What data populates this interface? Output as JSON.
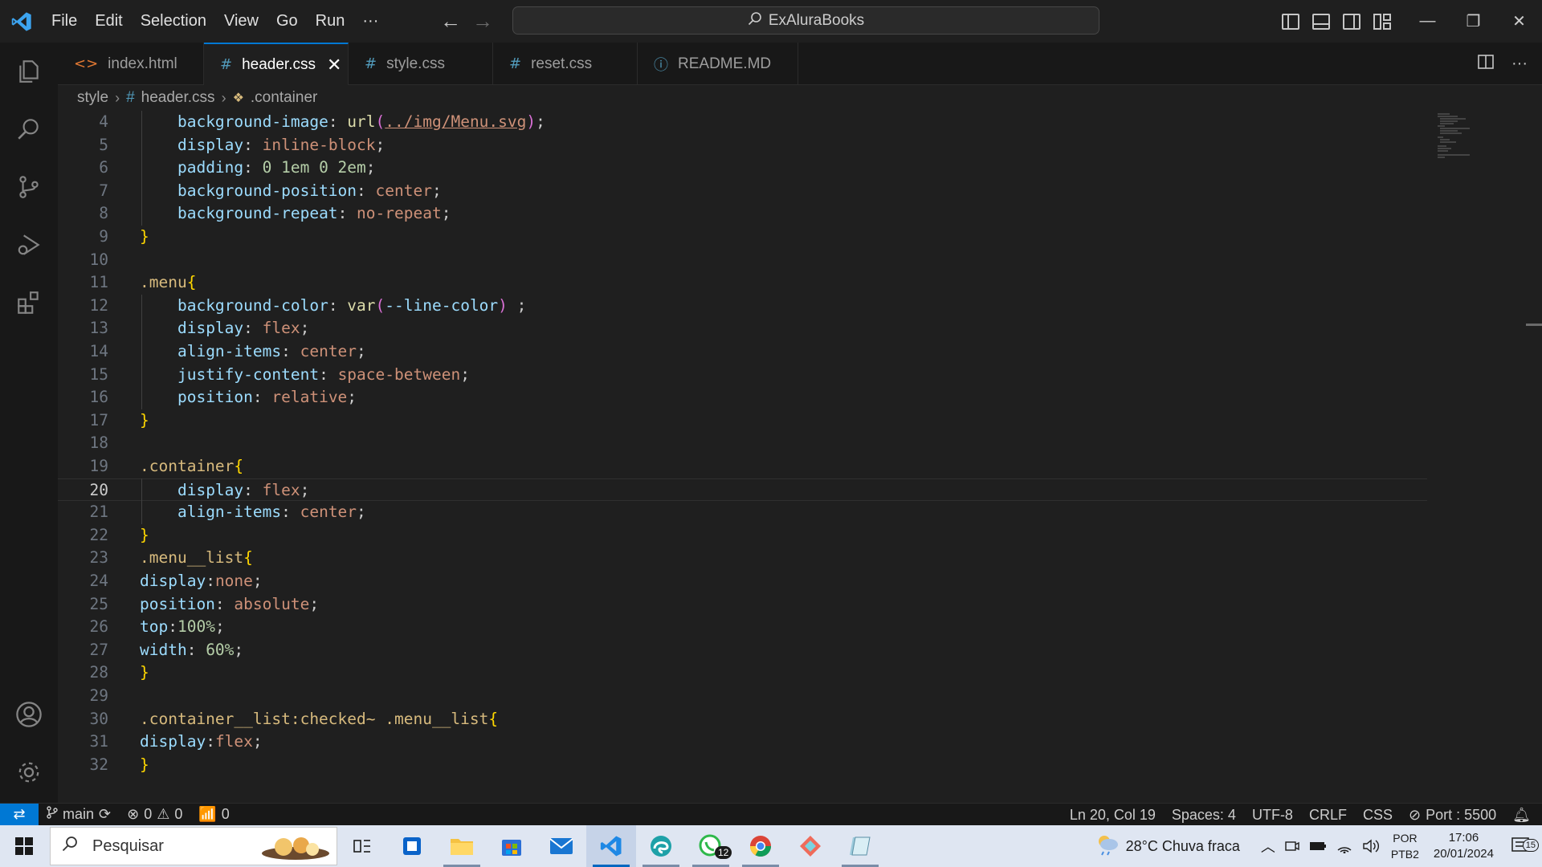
{
  "window": {
    "menu": [
      "File",
      "Edit",
      "Selection",
      "View",
      "Go",
      "Run",
      "···"
    ],
    "search_title": "ExAluraBooks",
    "nav_back_icon": "arrow-left-icon",
    "nav_forward_icon": "arrow-right-icon"
  },
  "tabs": [
    {
      "icon": "<>",
      "label": "index.html",
      "active": false,
      "icon_color": "#e37933"
    },
    {
      "icon": "#",
      "label": "header.css",
      "active": true,
      "icon_color": "#519aba"
    },
    {
      "icon": "#",
      "label": "style.css",
      "active": false,
      "icon_color": "#519aba"
    },
    {
      "icon": "#",
      "label": "reset.css",
      "active": false,
      "icon_color": "#519aba"
    },
    {
      "icon": "ⓘ",
      "label": "README.MD",
      "active": false,
      "icon_color": "#519aba"
    }
  ],
  "breadcrumb": {
    "folder": "style",
    "file": "header.css",
    "symbol": ".container"
  },
  "editor": {
    "current_line": 20,
    "lines": [
      {
        "n": "4",
        "tokens": [
          [
            "    ",
            ""
          ],
          [
            "background-image",
            "prop"
          ],
          [
            ": ",
            "punc"
          ],
          [
            "url",
            "fn"
          ],
          [
            "(",
            "brace2"
          ],
          [
            "../img/Menu.svg",
            "url"
          ],
          [
            ")",
            "brace2"
          ],
          [
            ";",
            "punc"
          ]
        ]
      },
      {
        "n": "5",
        "tokens": [
          [
            "    ",
            ""
          ],
          [
            "display",
            "prop"
          ],
          [
            ": ",
            "punc"
          ],
          [
            "inline-block",
            "val"
          ],
          [
            ";",
            "punc"
          ]
        ]
      },
      {
        "n": "6",
        "tokens": [
          [
            "    ",
            ""
          ],
          [
            "padding",
            "prop"
          ],
          [
            ": ",
            "punc"
          ],
          [
            "0 1em 0 2em",
            "num"
          ],
          [
            ";",
            "punc"
          ]
        ]
      },
      {
        "n": "7",
        "tokens": [
          [
            "    ",
            ""
          ],
          [
            "background-position",
            "prop"
          ],
          [
            ": ",
            "punc"
          ],
          [
            "center",
            "val"
          ],
          [
            ";",
            "punc"
          ]
        ]
      },
      {
        "n": "8",
        "tokens": [
          [
            "    ",
            ""
          ],
          [
            "background-repeat",
            "prop"
          ],
          [
            ": ",
            "punc"
          ],
          [
            "no-repeat",
            "val"
          ],
          [
            ";",
            "punc"
          ]
        ]
      },
      {
        "n": "9",
        "tokens": [
          [
            "}",
            "brace"
          ]
        ]
      },
      {
        "n": "10",
        "tokens": []
      },
      {
        "n": "11",
        "tokens": [
          [
            ".menu",
            "sel"
          ],
          [
            "{",
            "brace"
          ]
        ]
      },
      {
        "n": "12",
        "tokens": [
          [
            "    ",
            ""
          ],
          [
            "background-color",
            "prop"
          ],
          [
            ": ",
            "punc"
          ],
          [
            "var",
            "fn"
          ],
          [
            "(",
            "brace2"
          ],
          [
            "--line-color",
            "prop"
          ],
          [
            ")",
            "brace2"
          ],
          [
            " ;",
            "punc"
          ]
        ]
      },
      {
        "n": "13",
        "tokens": [
          [
            "    ",
            ""
          ],
          [
            "display",
            "prop"
          ],
          [
            ": ",
            "punc"
          ],
          [
            "flex",
            "val"
          ],
          [
            ";",
            "punc"
          ]
        ]
      },
      {
        "n": "14",
        "tokens": [
          [
            "    ",
            ""
          ],
          [
            "align-items",
            "prop"
          ],
          [
            ": ",
            "punc"
          ],
          [
            "center",
            "val"
          ],
          [
            ";",
            "punc"
          ]
        ]
      },
      {
        "n": "15",
        "tokens": [
          [
            "    ",
            ""
          ],
          [
            "justify-content",
            "prop"
          ],
          [
            ": ",
            "punc"
          ],
          [
            "space-between",
            "val"
          ],
          [
            ";",
            "punc"
          ]
        ]
      },
      {
        "n": "16",
        "tokens": [
          [
            "    ",
            ""
          ],
          [
            "position",
            "prop"
          ],
          [
            ": ",
            "punc"
          ],
          [
            "relative",
            "val"
          ],
          [
            ";",
            "punc"
          ]
        ]
      },
      {
        "n": "17",
        "tokens": [
          [
            "}",
            "brace"
          ]
        ]
      },
      {
        "n": "18",
        "tokens": []
      },
      {
        "n": "19",
        "tokens": [
          [
            ".container",
            "sel"
          ],
          [
            "{",
            "brace"
          ]
        ]
      },
      {
        "n": "20",
        "tokens": [
          [
            "    ",
            ""
          ],
          [
            "display",
            "prop"
          ],
          [
            ": ",
            "punc"
          ],
          [
            "flex",
            "val"
          ],
          [
            ";",
            "punc"
          ]
        ]
      },
      {
        "n": "21",
        "tokens": [
          [
            "    ",
            ""
          ],
          [
            "align-items",
            "prop"
          ],
          [
            ": ",
            "punc"
          ],
          [
            "center",
            "val"
          ],
          [
            ";",
            "punc"
          ]
        ]
      },
      {
        "n": "22",
        "tokens": [
          [
            "}",
            "brace"
          ]
        ]
      },
      {
        "n": "23",
        "tokens": [
          [
            ".menu__list",
            "sel"
          ],
          [
            "{",
            "brace"
          ]
        ]
      },
      {
        "n": "24",
        "tokens": [
          [
            "display",
            "prop"
          ],
          [
            ":",
            "punc"
          ],
          [
            "none",
            "val"
          ],
          [
            ";",
            "punc"
          ]
        ]
      },
      {
        "n": "25",
        "tokens": [
          [
            "position",
            "prop"
          ],
          [
            ": ",
            "punc"
          ],
          [
            "absolute",
            "val"
          ],
          [
            ";",
            "punc"
          ]
        ]
      },
      {
        "n": "26",
        "tokens": [
          [
            "top",
            "prop"
          ],
          [
            ":",
            "punc"
          ],
          [
            "100%",
            "num"
          ],
          [
            ";",
            "punc"
          ]
        ]
      },
      {
        "n": "27",
        "tokens": [
          [
            "width",
            "prop"
          ],
          [
            ": ",
            "punc"
          ],
          [
            "60%",
            "num"
          ],
          [
            ";",
            "punc"
          ]
        ]
      },
      {
        "n": "28",
        "tokens": [
          [
            "}",
            "brace"
          ]
        ]
      },
      {
        "n": "29",
        "tokens": []
      },
      {
        "n": "30",
        "tokens": [
          [
            ".container__list:checked~ .menu__list",
            "sel"
          ],
          [
            "{",
            "brace"
          ]
        ]
      },
      {
        "n": "31",
        "tokens": [
          [
            "display",
            "prop"
          ],
          [
            ":",
            "punc"
          ],
          [
            "flex",
            "val"
          ],
          [
            ";",
            "punc"
          ]
        ]
      },
      {
        "n": "32",
        "tokens": [
          [
            "}",
            "brace"
          ]
        ]
      }
    ]
  },
  "status": {
    "branch": "main",
    "errors": "0",
    "warnings": "0",
    "ports_count": "0",
    "position": "Ln 20, Col 19",
    "spaces": "Spaces: 4",
    "encoding": "UTF-8",
    "eol": "CRLF",
    "language": "CSS",
    "port": "Port : 5500"
  },
  "taskbar": {
    "search_placeholder": "Pesquisar",
    "whatsapp_badge": "12",
    "weather": "28°C  Chuva fraca",
    "lang_top": "POR",
    "lang_bottom": "PTB2",
    "time": "17:06",
    "date": "20/01/2024",
    "notifications": "15"
  },
  "colors": {
    "accent": "#0078d4",
    "editor_bg": "#1f1f1f"
  }
}
